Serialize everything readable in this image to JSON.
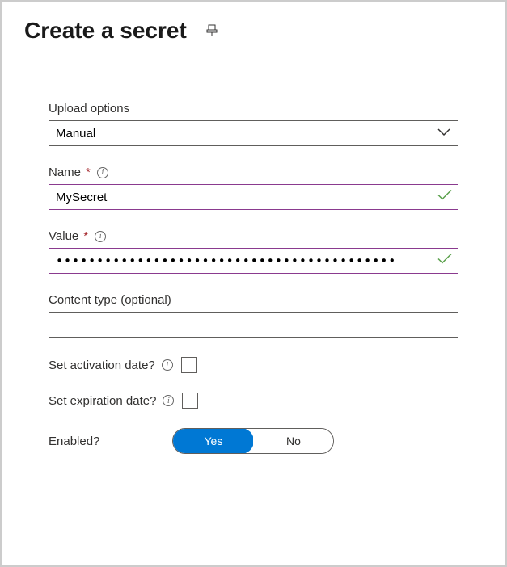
{
  "header": {
    "title": "Create a secret"
  },
  "form": {
    "upload_options": {
      "label": "Upload options",
      "value": "Manual"
    },
    "name": {
      "label": "Name",
      "required": "*",
      "value": "MySecret"
    },
    "value_field": {
      "label": "Value",
      "required": "*",
      "value": "••••••••••••••••••••••••••••••••••••••••••"
    },
    "content_type": {
      "label": "Content type (optional)",
      "value": ""
    },
    "activation": {
      "label": "Set activation date?"
    },
    "expiration": {
      "label": "Set expiration date?"
    },
    "enabled": {
      "label": "Enabled?",
      "yes": "Yes",
      "no": "No"
    }
  }
}
